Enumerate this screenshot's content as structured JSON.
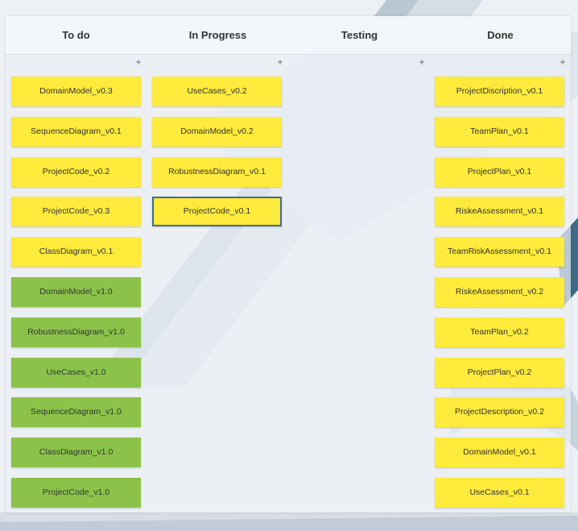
{
  "colors": {
    "yellow": "#ffeb3b",
    "green": "#8bc34a",
    "selected_border": "#3d6f94"
  },
  "add_icon": "+",
  "columns": [
    {
      "title": "To do",
      "cards": [
        {
          "label": "DomainModel_v0.3",
          "color": "yellow"
        },
        {
          "label": "SequenceDiagram_v0.1",
          "color": "yellow"
        },
        {
          "label": "ProjectCode_v0.2",
          "color": "yellow"
        },
        {
          "label": "ProjectCode_v0.3",
          "color": "yellow"
        },
        {
          "label": "ClassDiagram_v0.1",
          "color": "yellow"
        },
        {
          "label": "DomainModel_v1.0",
          "color": "green"
        },
        {
          "label": "RobustnessDiagram_v1.0",
          "color": "green"
        },
        {
          "label": "UseCases_v1.0",
          "color": "green"
        },
        {
          "label": "SequenceDiagram_v1.0",
          "color": "green"
        },
        {
          "label": "ClassDiagram_v1.0",
          "color": "green"
        },
        {
          "label": "ProjectCode_v1.0",
          "color": "green"
        }
      ]
    },
    {
      "title": "In Progress",
      "cards": [
        {
          "label": "UseCases_v0.2",
          "color": "yellow"
        },
        {
          "label": "DomainModel_v0.2",
          "color": "yellow"
        },
        {
          "label": "RobustnessDiagram_v0.1",
          "color": "yellow"
        },
        {
          "label": "ProjectCode_v0.1",
          "color": "yellow",
          "selected": true
        }
      ]
    },
    {
      "title": "Testing",
      "cards": []
    },
    {
      "title": "Done",
      "cards": [
        {
          "label": "ProjectDiscription_v0.1",
          "color": "yellow"
        },
        {
          "label": "TeamPlan_v0.1",
          "color": "yellow"
        },
        {
          "label": "ProjectPlan_v0.1",
          "color": "yellow"
        },
        {
          "label": "RiskeAssessment_v0.1",
          "color": "yellow"
        },
        {
          "label": "TeamRiskAssessment_v0.1",
          "color": "yellow"
        },
        {
          "label": "RiskeAssessment_v0.2",
          "color": "yellow"
        },
        {
          "label": "TeamPlan_v0.2",
          "color": "yellow"
        },
        {
          "label": "ProjectPlan_v0.2",
          "color": "yellow"
        },
        {
          "label": "ProjectDescription_v0.2",
          "color": "yellow"
        },
        {
          "label": "DomainModel_v0.1",
          "color": "yellow"
        },
        {
          "label": "UseCases_v0.1",
          "color": "yellow"
        }
      ]
    }
  ]
}
